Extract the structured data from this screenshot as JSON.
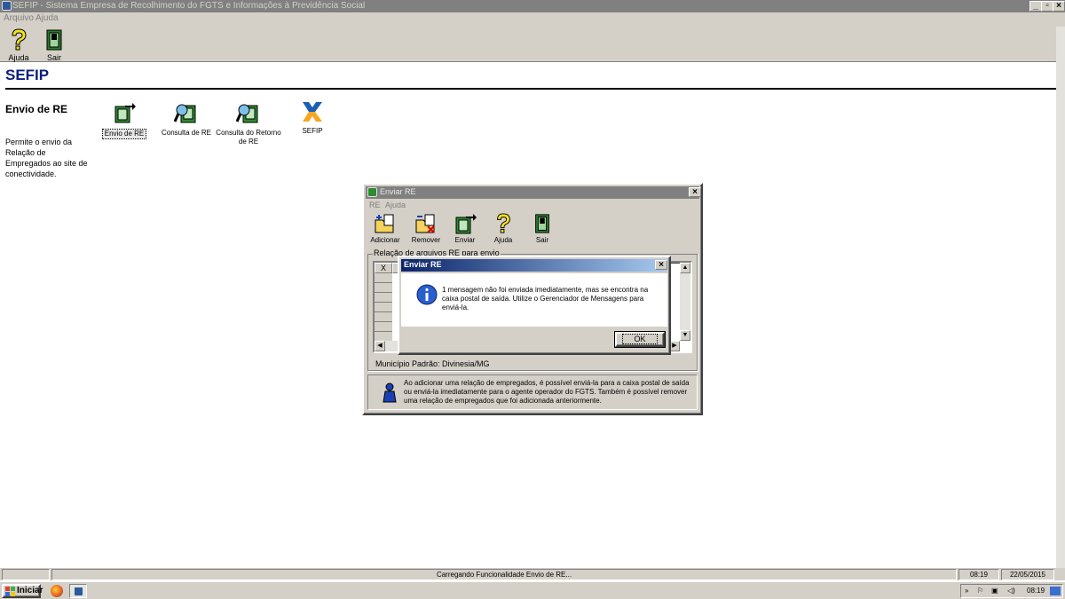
{
  "window": {
    "title": "SEFIP - Sistema Empresa de Recolhimento do FGTS e Informações à Previdência Social"
  },
  "menu": {
    "items": [
      "Arquivo",
      "Ajuda"
    ]
  },
  "toolbar": {
    "ajuda": "Ajuda",
    "sair": "Sair"
  },
  "page": {
    "title": "SEFIP"
  },
  "section": {
    "title": "Envio de RE",
    "description": "Permite o envio da Relação de Empregados ao site de conectividade."
  },
  "features": [
    {
      "label": "Envio de RE",
      "icon": "send-re-icon"
    },
    {
      "label": "Consulta de RE",
      "icon": "consulta-icon"
    },
    {
      "label": "Consulta do Retorno de RE",
      "icon": "consulta-retorno-icon"
    },
    {
      "label": "SEFIP",
      "icon": "caixa-logo-icon"
    }
  ],
  "dialog": {
    "title": "Enviar RE",
    "menu": [
      "RE",
      "Ajuda"
    ],
    "toolbar": [
      "Adicionar",
      "Remover",
      "Enviar",
      "Ajuda",
      "Sair"
    ],
    "group_label": "Relação de arquivos RE para envio",
    "table_header_x": "X",
    "municipio": "Município Padrão: Divinesia/MG",
    "info_text": "Ao adicionar uma relação de empregados, é possível enviá-la para a caixa postal de saída ou enviá-la imediatamente para o agente operador do FGTS. Também é possível remover uma relação de empregados que foi adicionada anteriormente."
  },
  "msgbox": {
    "title": "Enviar RE",
    "message": "1 mensagem não foi enviada imediatamente, mas se encontra na caixa postal de saída. Utilize o Gerenciador de Mensagens para enviá-la.",
    "ok_label": "OK"
  },
  "statusbar": {
    "message": "Carregando Funcionalidade Envio de RE...",
    "time": "08:19",
    "date": "22/05/2015"
  },
  "taskbar": {
    "start_label": "Iniciar",
    "clock": "08:19"
  },
  "colors": {
    "title_blue": "#0b1f7a",
    "active_title": "#0a246a",
    "face": "#d4d0c8"
  }
}
